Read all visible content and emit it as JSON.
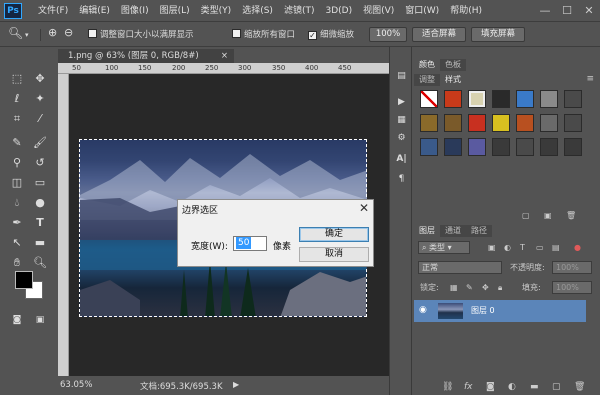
{
  "app": {
    "logo": "Ps"
  },
  "menu": [
    "文件(F)",
    "编辑(E)",
    "图像(I)",
    "图层(L)",
    "类型(Y)",
    "选择(S)",
    "滤镜(T)",
    "3D(D)",
    "视图(V)",
    "窗口(W)",
    "帮助(H)"
  ],
  "window_controls": {
    "minimize": "—",
    "maximize": "☐",
    "close": "✕"
  },
  "options": {
    "resize_window": "调整窗口大小以满屏显示",
    "zoom_all_windows": "缩放所有窗口",
    "scrubby_zoom": "细微缩放",
    "scrubby_zoom_checked": true,
    "btn_100": "100%",
    "btn_fit_screen": "适合屏幕",
    "btn_fill_screen": "填充屏幕"
  },
  "document": {
    "tab_title": "1.png @ 63% (图层 0, RGB/8#)",
    "tab_close": "×",
    "ruler_numbers": [
      "50",
      "100",
      "150",
      "200",
      "250",
      "300",
      "350",
      "400",
      "450"
    ],
    "zoom": "63.05%",
    "doc_size": "文档:695.3K/695.3K"
  },
  "dialog": {
    "title": "边界选区",
    "close": "✕",
    "width_label": "宽度(W):",
    "width_value": "50",
    "unit": "像素",
    "ok": "确定",
    "cancel": "取消"
  },
  "styles_panel": {
    "tabs_top": [
      "颜色",
      "色板"
    ],
    "tabs_bottom": [
      "调整",
      "样式"
    ],
    "swatches": [
      "#d23c3c",
      "#c83a1a",
      "#d8d2b0",
      "#2a2a2a",
      "#3a7ac8",
      "#8a8a8a",
      "#4a4a4a",
      "#8a6a2a",
      "#7a5a2a",
      "#c83020",
      "#d8c020",
      "#b85020",
      "#6a6a6a",
      "#4a4a4a",
      "#3a5a8a",
      "#2a3a5a",
      "#5a5aa0",
      "#3a3a3a",
      "#4a4a4a",
      "#3a3a3a",
      "#3a3a3a"
    ]
  },
  "layers_panel": {
    "tabs": [
      "图层",
      "通道",
      "路径"
    ],
    "kind_filter": "类型",
    "blend_mode": "正常",
    "opacity_label": "不透明度:",
    "opacity_value": "100%",
    "lock_label": "锁定:",
    "fill_label": "填充:",
    "fill_value": "100%",
    "layer_name": "图层 0"
  }
}
